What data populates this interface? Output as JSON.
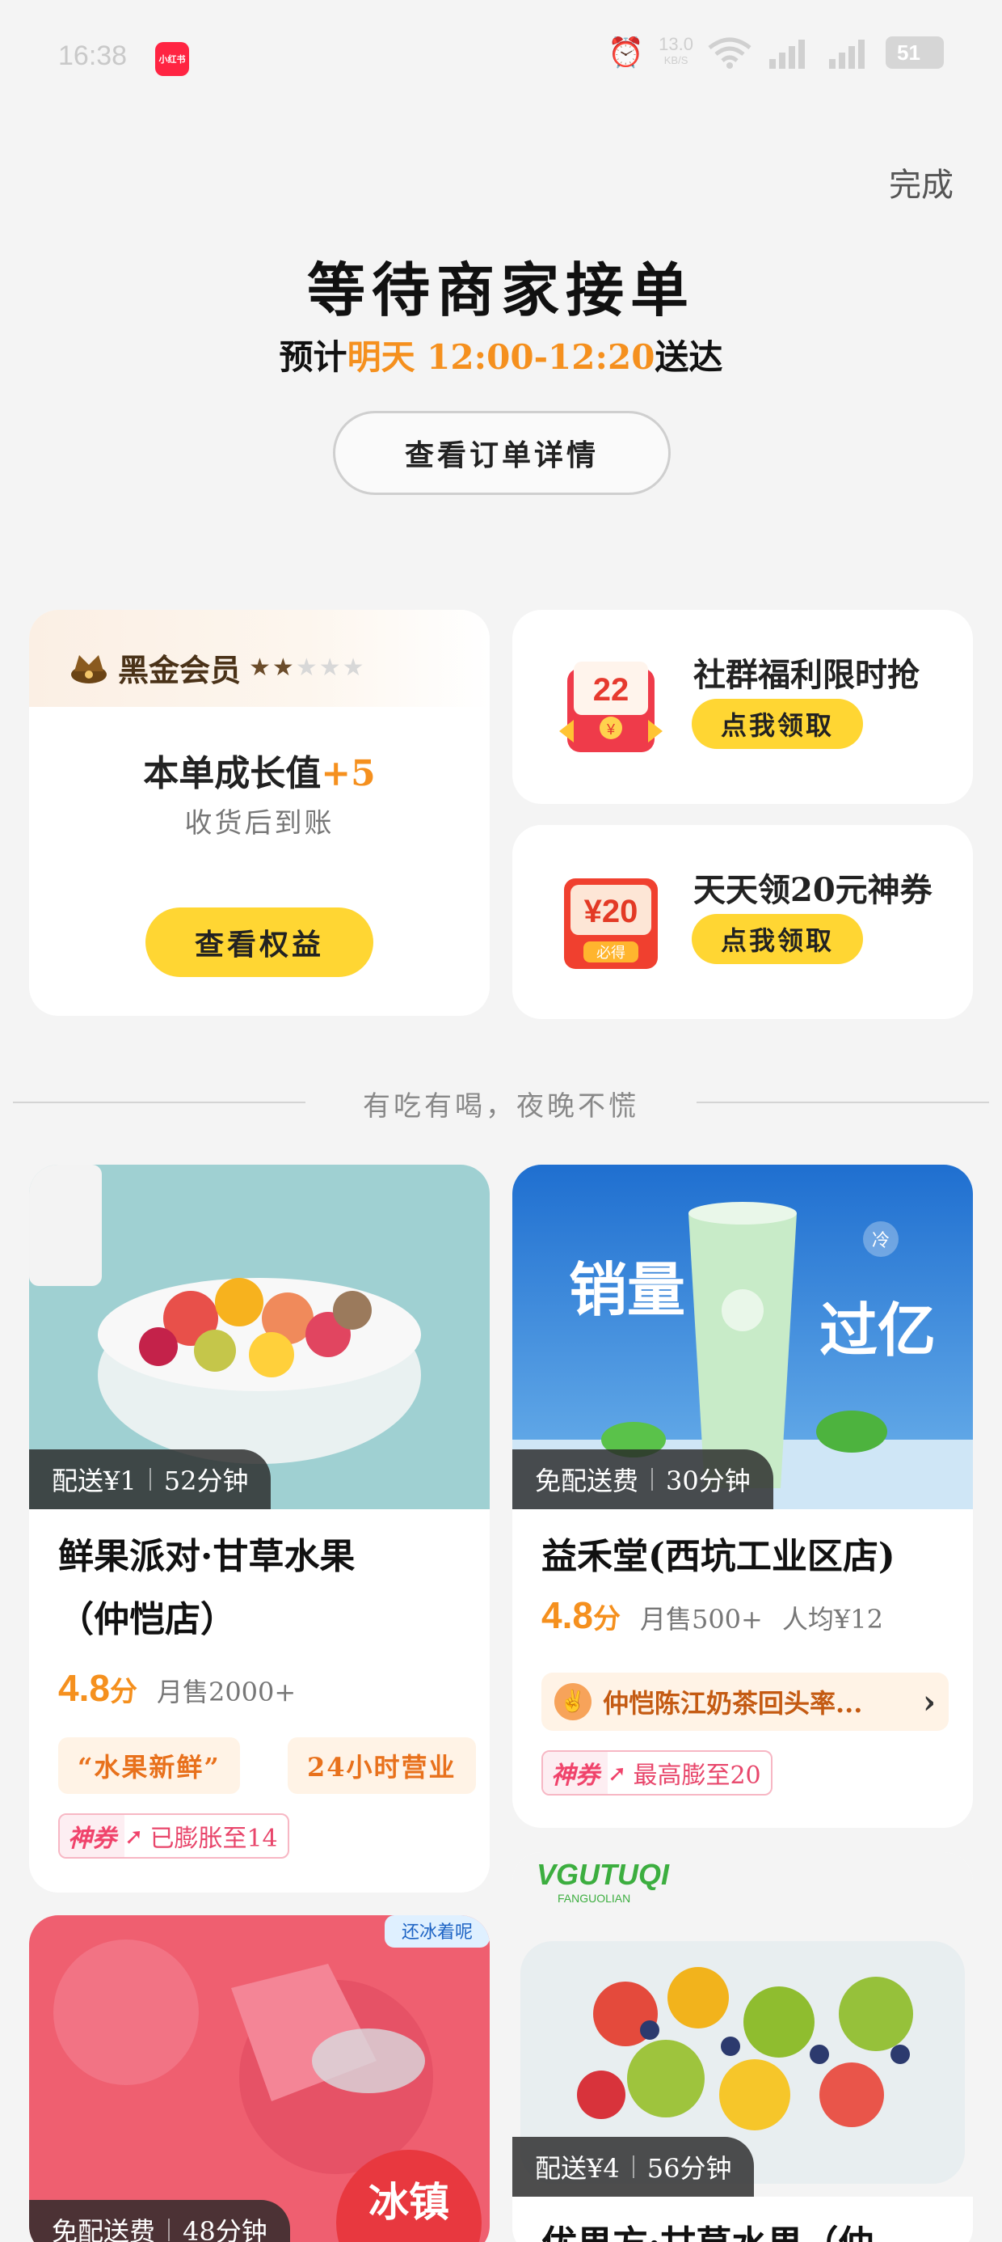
{
  "status_bar": {
    "time": "16:38",
    "app_badge": "小红书",
    "net_speed": "13.0",
    "net_unit": "KB/S",
    "battery": "51"
  },
  "header": {
    "done_label": "完成",
    "title": "等待商家接单",
    "eta_prefix": "预计",
    "eta_time": "明天 12:00-12:20",
    "eta_suffix": "送达",
    "detail_button": "查看订单详情"
  },
  "member_card": {
    "name": "黑金会员",
    "stars_on": "★★",
    "stars_off": "★★★",
    "growth_text": "本单成长值",
    "growth_plus": "+5",
    "growth_sub": "收货后到账",
    "button": "查看权益"
  },
  "promos": [
    {
      "title": "社群福利限时抢",
      "button": "点我领取",
      "image_text": "22",
      "image_sub": "¥"
    },
    {
      "title": "天天领20元神券",
      "button": "点我领取",
      "image_text": "¥20",
      "image_sub": "必得"
    }
  ],
  "divider_text": "有吃有喝，夜晚不慌",
  "stores": [
    {
      "fee": "配送¥1",
      "time": "52分钟",
      "name_line1": "鲜果派对·甘草水果",
      "name_line2": "（仲恺店）",
      "score": "4.8",
      "score_unit": "分",
      "sales": "月售2000+",
      "chips": [
        "“水果新鲜”",
        "24小时营业"
      ],
      "coupon_label": "神券",
      "coupon_text": "已膨胀至14"
    },
    {
      "fee": "免配送费",
      "time": "30分钟",
      "name_line1": "益禾堂(西坑工业区店)",
      "score": "4.8",
      "score_unit": "分",
      "sales": "月售500+",
      "avg": "人均¥12",
      "promo_line": "仲恺陈江奶茶回头率...",
      "coupon_label": "神券",
      "coupon_text": "最高膨至20",
      "image_text_left": "销量",
      "image_text_right": "过亿",
      "image_badge": "冷"
    },
    {
      "fee": "免配送费",
      "time": "48分钟",
      "image_badge": "冰镇",
      "image_corner": "还冰着呢"
    },
    {
      "fee": "配送¥4",
      "time": "56分钟",
      "image_brand": "VGUTUQI",
      "image_brand_sub": "FANGUOLIAN",
      "name_partial": "优果方·甘草水果（仲"
    }
  ],
  "colors": {
    "accent_orange": "#f5901e",
    "button_yellow": "#ffd633",
    "coupon_pink": "#f0436b"
  }
}
